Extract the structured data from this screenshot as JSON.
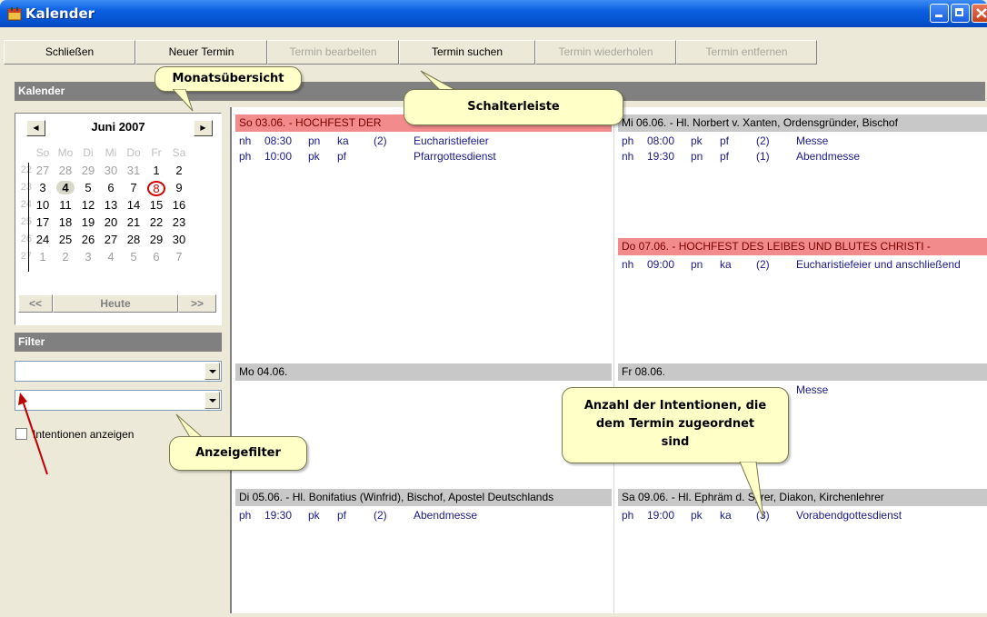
{
  "window": {
    "title": "Kalender",
    "icon": "calendar-app-icon"
  },
  "toolbar": {
    "buttons": [
      {
        "label": "Schließen",
        "enabled": true
      },
      {
        "label": "Neuer Termin",
        "enabled": true
      },
      {
        "label": "Termin bearbeiten",
        "enabled": false
      },
      {
        "label": "Termin suchen",
        "enabled": true
      },
      {
        "label": "Termin wiederholen",
        "enabled": false
      },
      {
        "label": "Termin entfernen",
        "enabled": false
      }
    ]
  },
  "sidebar": {
    "calendar_header": "Kalender",
    "month": "Juni 2007",
    "prev_icon": "arrow-left-icon",
    "next_icon": "arrow-right-icon",
    "weekdays": [
      "So",
      "Mo",
      "Di",
      "Mi",
      "Do",
      "Fr",
      "Sa"
    ],
    "weeks": [
      {
        "kw": "22",
        "days": [
          "27",
          "28",
          "29",
          "30",
          "31",
          "1",
          "2"
        ]
      },
      {
        "kw": "23",
        "days": [
          "3",
          "4",
          "5",
          "6",
          "7",
          "8",
          "9"
        ]
      },
      {
        "kw": "24",
        "days": [
          "10",
          "11",
          "12",
          "13",
          "14",
          "15",
          "16"
        ]
      },
      {
        "kw": "25",
        "days": [
          "17",
          "18",
          "19",
          "20",
          "21",
          "22",
          "23"
        ]
      },
      {
        "kw": "26",
        "days": [
          "24",
          "25",
          "26",
          "27",
          "28",
          "29",
          "30"
        ]
      },
      {
        "kw": "27",
        "days": [
          "1",
          "2",
          "3",
          "4",
          "5",
          "6",
          "7"
        ]
      }
    ],
    "today_day": "4",
    "circled_day": "8",
    "footer": {
      "prev": "<<",
      "today": "Heute",
      "next": ">>"
    },
    "filter_header": "Filter",
    "filter1_value": "",
    "filter2_value": "",
    "show_intentions_label": "Intentionen anzeigen"
  },
  "days": [
    {
      "header": "So 03.06. - HOCHFEST DER",
      "feast": true,
      "entries": [
        {
          "loc": "nh",
          "time": "08:30",
          "p1": "pn",
          "p2": "ka",
          "count": "(2)",
          "title": "Eucharistiefeier"
        },
        {
          "loc": "ph",
          "time": "10:00",
          "p1": "pk",
          "p2": "pf",
          "count": "",
          "title": "Pfarrgottesdienst"
        }
      ]
    },
    {
      "header": "Mi 06.06. - Hl. Norbert v. Xanten, Ordensgründer, Bischof",
      "feast": false,
      "entries": [
        {
          "loc": "ph",
          "time": "08:00",
          "p1": "pk",
          "p2": "pf",
          "count": "(2)",
          "title": "Messe"
        },
        {
          "loc": "nh",
          "time": "19:30",
          "p1": "pn",
          "p2": "pf",
          "count": "(1)",
          "title": "Abendmesse"
        }
      ]
    },
    {
      "header": "Do 07.06. - HOCHFEST DES LEIBES UND BLUTES CHRISTI -",
      "feast": true,
      "entries": [
        {
          "loc": "nh",
          "time": "09:00",
          "p1": "pn",
          "p2": "ka",
          "count": "(2)",
          "title": "Eucharistiefeier und anschließend"
        }
      ]
    },
    {
      "header": "Mo 04.06.",
      "feast": false,
      "entries": []
    },
    {
      "header": "Fr 08.06.",
      "feast": false,
      "entries": [
        {
          "loc": "",
          "time": "",
          "p1": "",
          "p2": "",
          "count": "",
          "title": "Messe"
        }
      ]
    },
    {
      "header": "Di 05.06. - Hl. Bonifatius (Winfrid), Bischof, Apostel Deutschlands",
      "feast": false,
      "entries": [
        {
          "loc": "ph",
          "time": "19:30",
          "p1": "pk",
          "p2": "pf",
          "count": "(2)",
          "title": "Abendmesse"
        }
      ]
    },
    {
      "header": "Sa 09.06. - Hl. Ephräm d. Syrer, Diakon, Kirchenlehrer",
      "feast": false,
      "entries": [
        {
          "loc": "ph",
          "time": "19:00",
          "p1": "pk",
          "p2": "ka",
          "count": "(3)",
          "title": "Vorabendgottesdienst"
        }
      ]
    }
  ],
  "callouts": {
    "month": "Monatsübersicht",
    "toolbar": "Schalterleiste",
    "filter": "Anzeigefilter",
    "intentions": "Anzahl der Intentionen, die dem Termin zugeordnet sind"
  },
  "colors": {
    "feast_bg": "#f28b8b",
    "entry_text": "#1a1a8a",
    "arrow": "#c00000"
  }
}
